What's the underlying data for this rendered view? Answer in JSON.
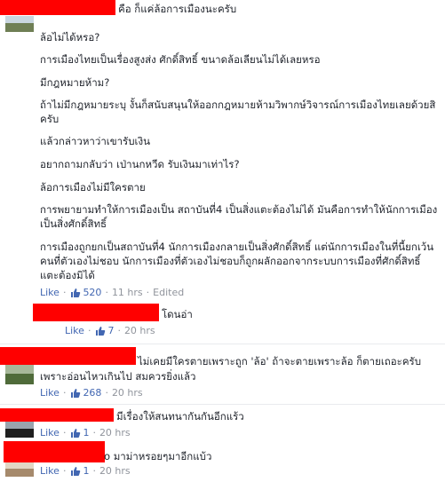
{
  "main_comment": {
    "header_text": "คือ ก็แค่ล้อการเมืองนะครับ",
    "paragraphs": [
      "ล้อไม่ได้หรอ?",
      "การเมืองไทยเป็นเรื่องสูงส่ง ศักดิ์สิทธิ์ ขนาดล้อเลียนไม่ได้เลยหรอ",
      "มีกฎหมายห้าม?",
      "ถ้าไม่มีกฎหมายระบุ งั้นก็สนับสนุนให้ออกกฎหมายห้ามวิพากษ์วิจารณ์การเมืองไทยเลยด้วยสิ",
      "ครับ",
      "แล้วกล่าวหาว่าเขารับเงิน",
      "อยากถามกลับว่า เป่านกหวีด รับเงินมาเท่าไร?",
      "ล้อการเมืองไม่มีใครตาย",
      "การพยายามทำให้การเมืองเป็น สถาบันที่4 เป็นสิ่งแตะต้องไม่ได้ มันคือการทำให้นักการเมือง",
      "เป็นสิ่งศักดิ์สิทธิ์",
      "การเมืองถูกยกเป็นสถาบันที่4 นักการเมืองกลายเป็นสิ่งศักดิ์สิทธิ์ แต่นักการเมืองในที่นี้ยกเว้น",
      "คนที่ตัวเองไม่ชอบ นักการเมืองที่ตัวเองไม่ชอบก็ถูกผลักออกจากระบบการเมืองที่ศักดิ์สิทธิ์",
      "แตะต้องมิได้"
    ],
    "like_label": "Like",
    "like_count": "520",
    "time": "11 hrs",
    "edited": "Edited"
  },
  "replies": [
    {
      "text": "โดนอ่า",
      "like_label": "Like",
      "like_count": "7",
      "time": "20 hrs"
    },
    {
      "text_line1": "ไม่เคยมีใครตายเพราะถูก 'ล้อ' ถ้าจะตายเพราะล้อ ก็ตายเถอะครับ",
      "text_line2": "เพราะอ่อนไหวเกินไป สมควรยิ่งแล้ว",
      "like_label": "Like",
      "like_count": "268",
      "time": "20 hrs"
    },
    {
      "text": "มีเรื่องให้สนทนากันกันอีกแร้ว",
      "like_label": "Like",
      "like_count": "1",
      "time": "20 hrs"
    },
    {
      "text": "o มาม่าหรอยๆมาอีกแบ้ว",
      "like_label": "Like",
      "like_count": "1",
      "time": "20 hrs"
    }
  ],
  "colors": {
    "redaction": "#ff0000",
    "link": "#4267b2",
    "meta": "#90949c",
    "text": "#1d2129"
  },
  "icons": {
    "like": "thumbs-up-icon",
    "separator": "middle-dot"
  }
}
